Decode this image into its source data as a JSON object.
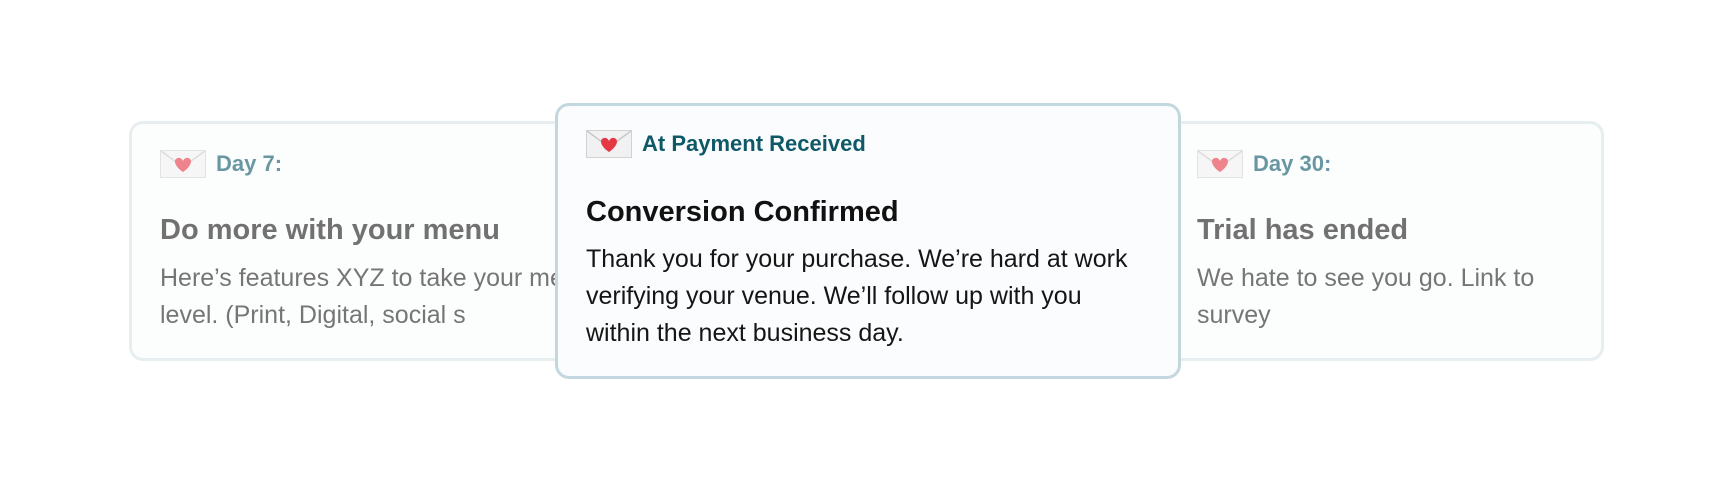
{
  "cards": {
    "left": {
      "icon": "love-letter-icon",
      "tag": "Day 7:",
      "title": "Do more with your menu",
      "body": "Here’s features XYZ to take your menu to the next level. (Print, Digital, social s"
    },
    "center": {
      "icon": "love-letter-icon",
      "tag": "At Payment Received",
      "title": "Conversion Confirmed",
      "body": "Thank you for your purchase. We’re hard at work verifying your venue. We’ll follow up with you within the next business day."
    },
    "right": {
      "icon": "love-letter-icon",
      "tag": "Day 30:",
      "title": "Trial has ended",
      "body": "We hate to see you go. Link to survey"
    }
  },
  "colors": {
    "tag": "#0f5868",
    "card_border": "#d7e4e8",
    "card_border_active": "#c3d8de",
    "card_background": "#fbfcfd",
    "heart": "#e53845"
  }
}
